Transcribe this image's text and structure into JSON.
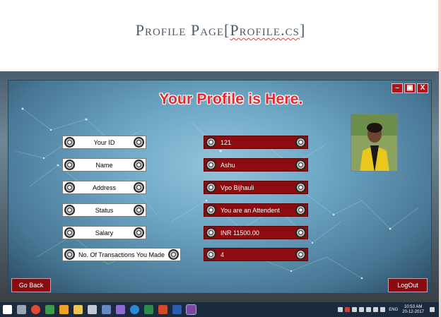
{
  "slide": {
    "title_prefix": "Profile Page[",
    "title_link": "Profile.cs",
    "title_suffix": "]"
  },
  "window": {
    "minimize_label": "–",
    "maximize_label": "▣",
    "close_label": "X"
  },
  "headline": "Your Profile is Here.",
  "fields": [
    {
      "label": "Your ID",
      "value": "121"
    },
    {
      "label": "Name",
      "value": "Ashu"
    },
    {
      "label": "Address",
      "value": "Vpo Bijhauli"
    },
    {
      "label": "Status",
      "value": "You are an Attendent"
    },
    {
      "label": "Salary",
      "value": "INR 11500.00"
    },
    {
      "label": "No. Of Transactions You Made",
      "value": "4"
    }
  ],
  "buttons": {
    "go_back": "Go Back",
    "logout": "LogOut"
  },
  "taskbar": {
    "language": "ENG",
    "time": "10:53 AM",
    "date": "20-12-2017",
    "icons": [
      "windows-icon",
      "task-view-icon",
      "chrome-icon",
      "file-icon",
      "store-icon",
      "folder-icon",
      "tools-icon",
      "app-icon",
      "link-icon",
      "edge-icon",
      "excel-icon",
      "powerpoint-icon",
      "word-icon",
      "visual-studio-icon"
    ]
  }
}
